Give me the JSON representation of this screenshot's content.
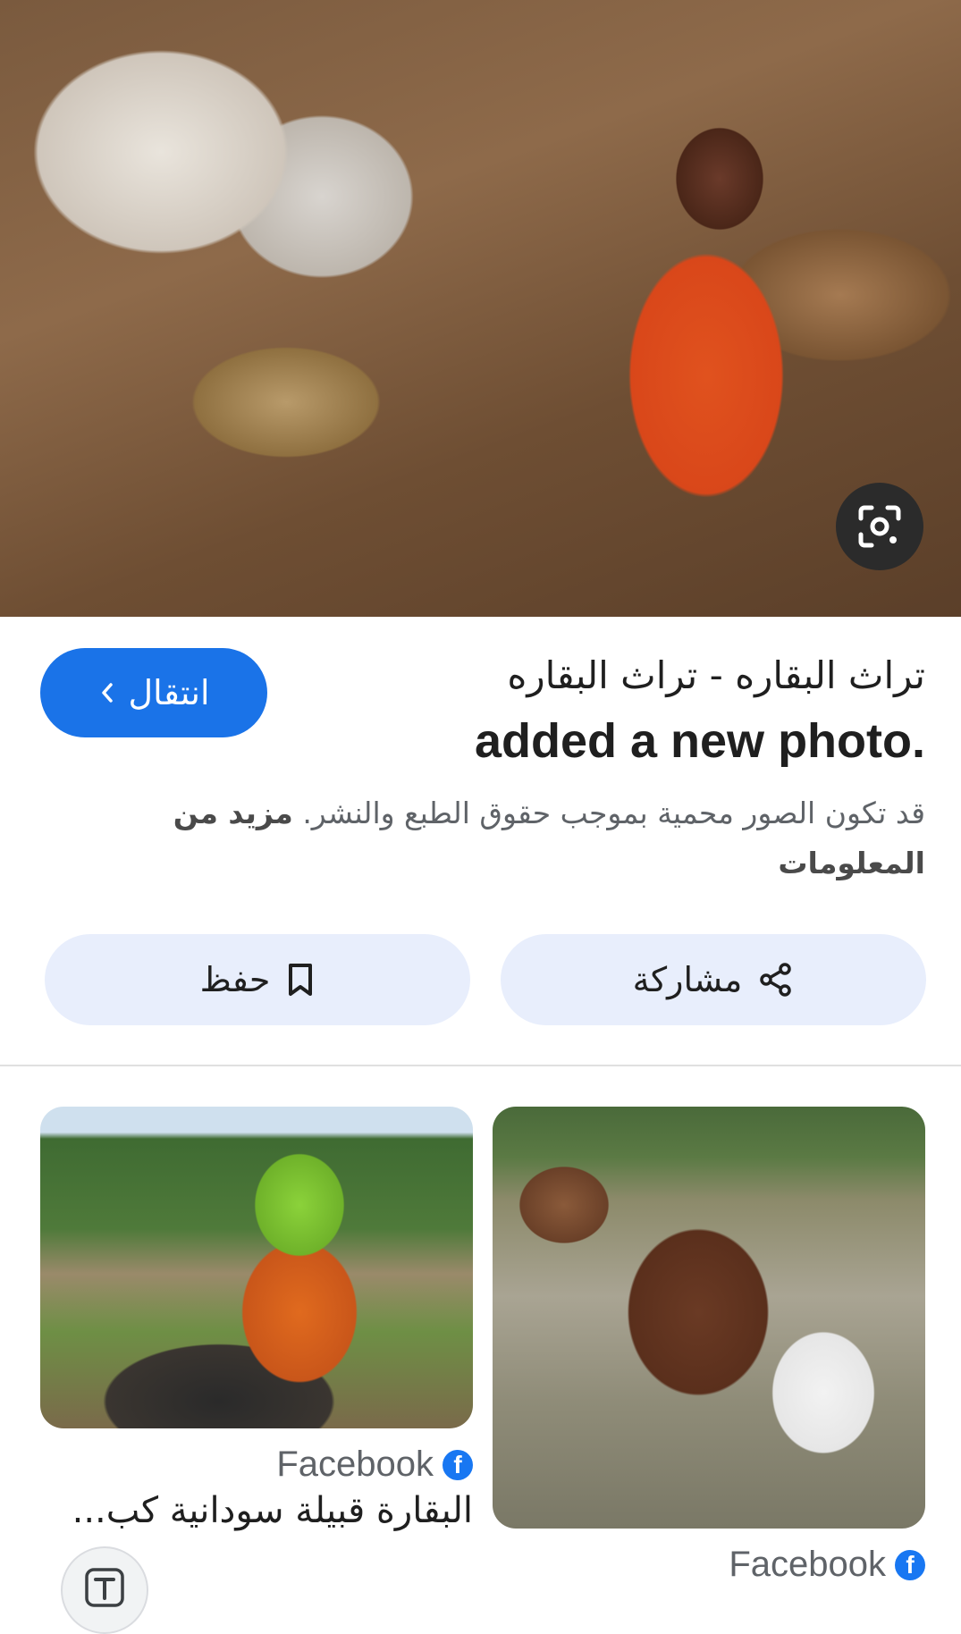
{
  "hero": {
    "image_alt": "",
    "lens_icon": "lens-search-icon"
  },
  "result": {
    "title": "تراث البقاره - تراث البقاره",
    "subtitle": "added a new photo.",
    "visit_label": "انتقال",
    "notice_text": "قد تكون الصور محمية بموجب حقوق الطبع والنشر.",
    "notice_link": "مزيد من المعلومات"
  },
  "actions": {
    "share_label": "مشاركة",
    "save_label": "حفظ"
  },
  "related": [
    {
      "source": "Facebook",
      "caption": ""
    },
    {
      "source": "Facebook",
      "caption": "البقارة قبيلة سودانية كب..."
    }
  ],
  "colors": {
    "accent": "#1a73e8",
    "pill_bg": "#e8eefc",
    "facebook": "#1877f2"
  }
}
